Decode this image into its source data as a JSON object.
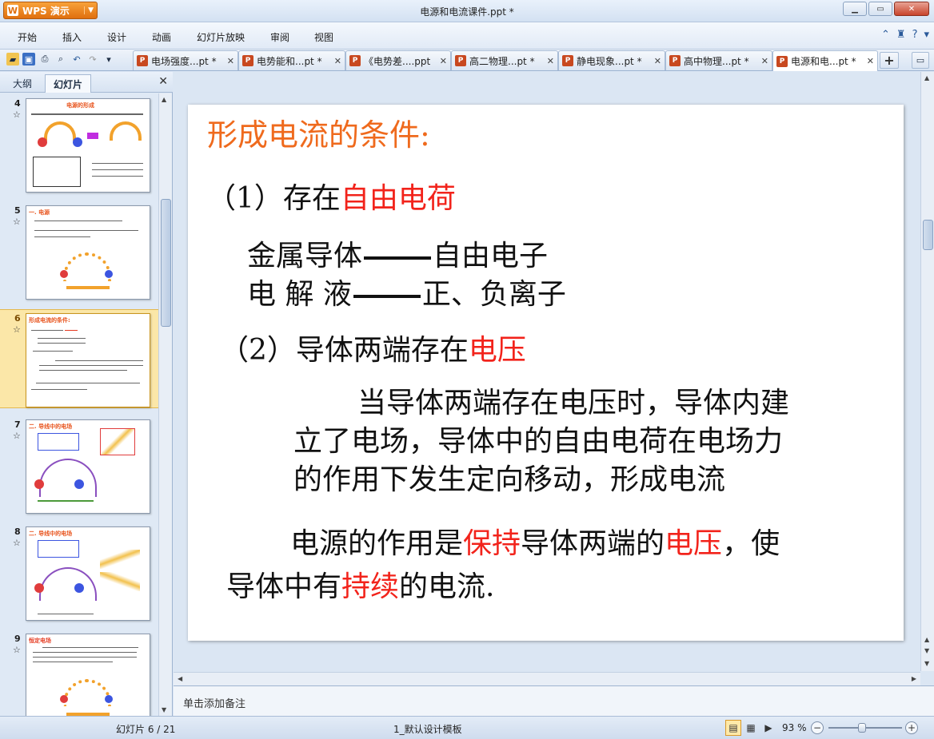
{
  "app": {
    "brand": "WPS 演示",
    "window_title": "电源和电流课件.ppt *"
  },
  "menu": [
    "开始",
    "插入",
    "设计",
    "动画",
    "幻灯片放映",
    "审阅",
    "视图"
  ],
  "tabs": [
    {
      "label": "电场强度...pt *"
    },
    {
      "label": "电势能和...pt *"
    },
    {
      "label": "《电势差....ppt"
    },
    {
      "label": "高二物理...pt *"
    },
    {
      "label": "静电现象...pt *"
    },
    {
      "label": "高中物理...pt *"
    },
    {
      "label": "电源和电...pt *"
    }
  ],
  "panel": {
    "tab_outline": "大纲",
    "tab_slides": "幻灯片"
  },
  "thumbnails": [
    {
      "num": "4",
      "title": "电源的形成"
    },
    {
      "num": "5",
      "title": "一. 电源"
    },
    {
      "num": "6",
      "title": "形成电流的条件:"
    },
    {
      "num": "7",
      "title": "二. 导线中的电场"
    },
    {
      "num": "8",
      "title": "二. 导线中的电场"
    },
    {
      "num": "9",
      "title": "恒定电场"
    }
  ],
  "slide": {
    "heading": "形成电流的条件:",
    "c1_prefix": "（1）存在",
    "c1_red": "自由电荷",
    "metal_left": "金属导体",
    "metal_right": "自由电子",
    "elec_left": "电  解  液",
    "elec_right": "正、负离子",
    "c2_prefix": "（2）导体两端存在",
    "c2_red": "电压",
    "para_line1": "当导体两端存在电压时，导体内建",
    "para_line2": "立了电场，导体中的自由电荷在电场力",
    "para_line3": "的作用下发生定向移动，形成电流",
    "final_a": "电源的作用是",
    "final_b": "保持",
    "final_c": "导体两端的",
    "final_d": "电压",
    "final_e": "，使",
    "final2_a": "导体中有",
    "final2_b": "持续",
    "final2_c": "的电流."
  },
  "notes_placeholder": "单击添加备注",
  "status": {
    "slide_counter": "幻灯片 6 / 21",
    "template": "1_默认设计模板",
    "zoom": "93 %"
  },
  "zoom_level_percent": 93,
  "colors": {
    "accent_orange": "#ef6a1d",
    "emphasis_red": "#f2231b",
    "selection": "#fbe7a8"
  }
}
